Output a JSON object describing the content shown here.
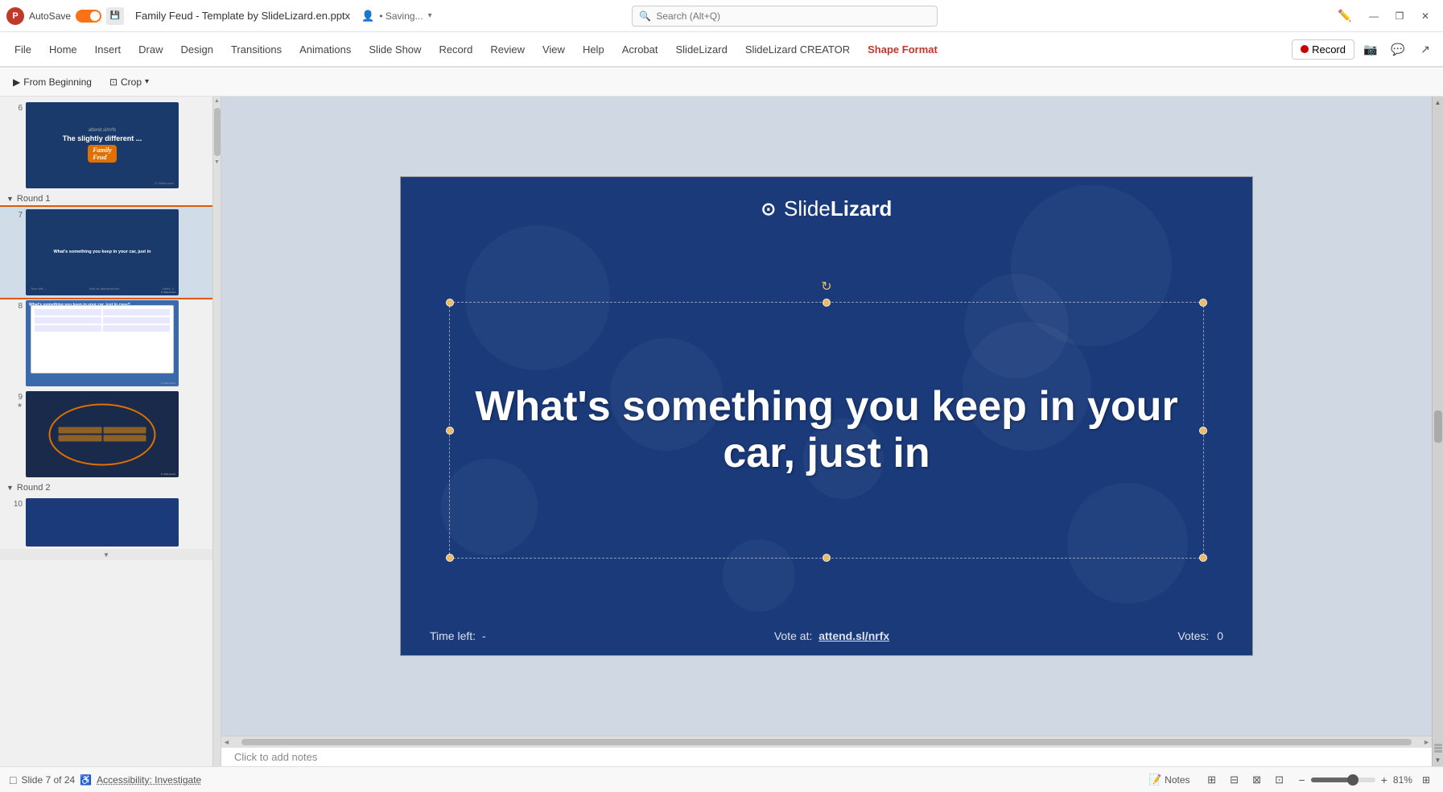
{
  "titlebar": {
    "app_logo": "P",
    "autosave_label": "AutoSave",
    "toggle_state": "on",
    "file_title": "Family Feud - Template by SlideLizard.en.pptx",
    "saving_status": "• Saving...",
    "search_placeholder": "Search (Alt+Q)",
    "window_controls": {
      "minimize": "—",
      "restore": "❐",
      "close": "✕"
    }
  },
  "ribbon": {
    "tabs": [
      {
        "label": "File",
        "id": "file"
      },
      {
        "label": "Home",
        "id": "home"
      },
      {
        "label": "Insert",
        "id": "insert"
      },
      {
        "label": "Draw",
        "id": "draw"
      },
      {
        "label": "Design",
        "id": "design"
      },
      {
        "label": "Transitions",
        "id": "transitions"
      },
      {
        "label": "Animations",
        "id": "animations"
      },
      {
        "label": "Slide Show",
        "id": "slideshow"
      },
      {
        "label": "Record",
        "id": "record"
      },
      {
        "label": "Review",
        "id": "review"
      },
      {
        "label": "View",
        "id": "view"
      },
      {
        "label": "Help",
        "id": "help"
      },
      {
        "label": "Acrobat",
        "id": "acrobat"
      },
      {
        "label": "SlideLizard",
        "id": "slidelizard"
      },
      {
        "label": "SlideLizard CREATOR",
        "id": "slidelizard-creator"
      },
      {
        "label": "Shape Format",
        "id": "shape-format",
        "active": true
      }
    ],
    "record_button": "Record"
  },
  "toolbar": {
    "from_beginning": "From Beginning",
    "crop": "Crop",
    "dropdown_arrow": "▾"
  },
  "slide_panel": {
    "sections": [
      {
        "label": "Round 1",
        "collapsed": false,
        "slides": [
          {
            "number": "7",
            "star": false,
            "type": "question",
            "text": "What's something you keep in your car, just in",
            "active": true
          },
          {
            "number": "8",
            "star": false,
            "type": "answers",
            "text": "What's something you keep in your car, just in case?"
          },
          {
            "number": "9",
            "star": true,
            "type": "scoreboard",
            "text": ""
          }
        ]
      },
      {
        "label": "Round 2",
        "collapsed": false,
        "slides": []
      }
    ],
    "earlier_slide": {
      "number": "6",
      "type": "title-slide"
    }
  },
  "slide": {
    "logo_text_light": "Slide",
    "logo_text_bold": "Lizard",
    "main_text": "What's something you keep in your car, just in",
    "time_left_label": "Time left:",
    "time_left_value": "-",
    "vote_label": "Vote at:",
    "vote_url": "attend.sl/nrfx",
    "votes_label": "Votes:",
    "votes_value": "0"
  },
  "status_bar": {
    "slide_info": "Slide 7 of 24",
    "accessibility": "Accessibility: Investigate",
    "notes_label": "Notes",
    "zoom_level": "81%",
    "fit_icon": "⊞"
  },
  "colors": {
    "accent": "#e05a00",
    "slide_bg": "#1a3a7a",
    "shape_format_color": "#c0392b",
    "record_dot": "#cc0000"
  }
}
